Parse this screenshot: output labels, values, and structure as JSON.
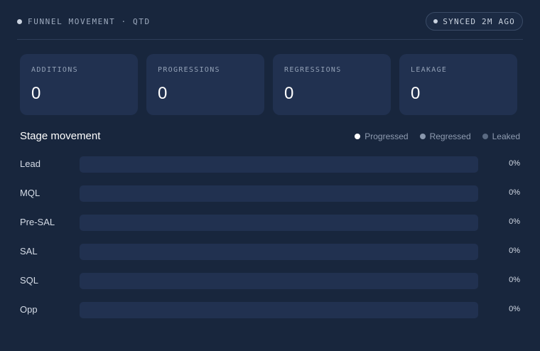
{
  "header": {
    "title": "FUNNEL MOVEMENT · QTD",
    "sync_label": "SYNCED 2M AGO"
  },
  "metrics": [
    {
      "label": "ADDITIONS",
      "value": "0"
    },
    {
      "label": "PROGRESSIONS",
      "value": "0"
    },
    {
      "label": "REGRESSIONS",
      "value": "0"
    },
    {
      "label": "LEAKAGE",
      "value": "0"
    }
  ],
  "section": {
    "title": "Stage movement",
    "legend": [
      {
        "label": "Progressed",
        "color": "#ffffff"
      },
      {
        "label": "Regressed",
        "color": "#8a98ad"
      },
      {
        "label": "Leaked",
        "color": "#5a6a82"
      }
    ]
  },
  "stages": [
    {
      "label": "Lead",
      "percent": "0%",
      "progress": 0
    },
    {
      "label": "MQL",
      "percent": "0%",
      "progress": 0
    },
    {
      "label": "Pre-SAL",
      "percent": "0%",
      "progress": 0
    },
    {
      "label": "SAL",
      "percent": "0%",
      "progress": 0
    },
    {
      "label": "SQL",
      "percent": "0%",
      "progress": 0
    },
    {
      "label": "Opp",
      "percent": "0%",
      "progress": 0
    }
  ],
  "colors": {
    "background": "#18263d",
    "card": "#213150",
    "accent": "#ffffff"
  }
}
